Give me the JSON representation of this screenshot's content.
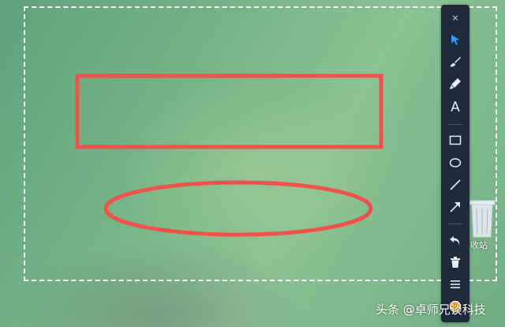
{
  "desktop": {
    "recycle_bin_label": "收站"
  },
  "toolbar": {
    "close_label": "×",
    "text_tool_label": "A",
    "tools": [
      "select-arrow",
      "brush",
      "marker",
      "text",
      "rectangle",
      "ellipse",
      "line",
      "arrow",
      "undo",
      "delete",
      "menu",
      "color-picker"
    ]
  },
  "annotations": {
    "stroke_color": "#f0524b",
    "selection_color": "#ffffff",
    "select_tool_color": "#2f9bff"
  },
  "watermark": {
    "text": "头条 @卓师兄谈科技"
  }
}
